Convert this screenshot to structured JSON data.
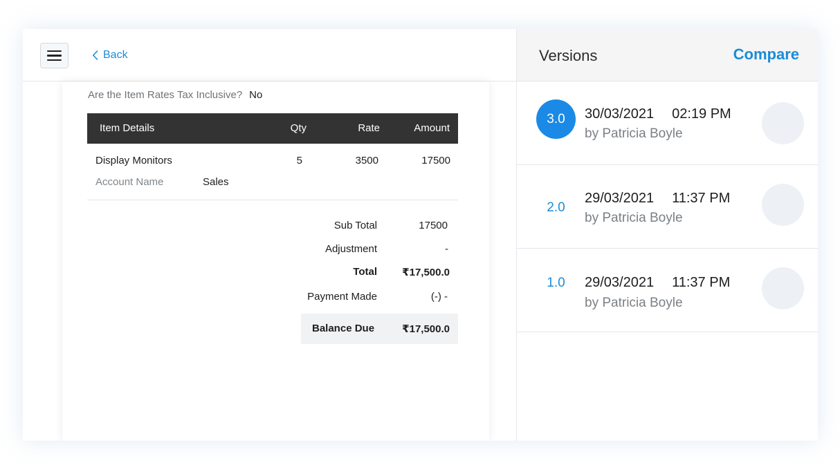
{
  "header": {
    "back_label": "Back"
  },
  "document": {
    "tax_question": "Are the Item Rates Tax Inclusive?",
    "tax_answer": "No",
    "table": {
      "columns": {
        "item": "Item Details",
        "qty": "Qty",
        "rate": "Rate",
        "amount": "Amount"
      },
      "rows": [
        {
          "name": "Display Monitors",
          "qty": "5",
          "rate": "3500",
          "amount": "17500",
          "account_label": "Account Name",
          "account_value": "Sales"
        }
      ]
    },
    "totals": {
      "subtotal_label": "Sub Total",
      "subtotal_value": "17500",
      "adjustment_label": "Adjustment",
      "adjustment_value": "-",
      "total_label": "Total",
      "total_value": "₹17,500.0",
      "payment_label": "Payment Made",
      "payment_value": "(-) -",
      "balance_label": "Balance Due",
      "balance_value": "₹17,500.0"
    }
  },
  "versions": {
    "title": "Versions",
    "compare_label": "Compare",
    "items": [
      {
        "version": "3.0",
        "date": "30/03/2021",
        "time": "02:19 PM",
        "by": "by Patricia Boyle",
        "active": true
      },
      {
        "version": "2.0",
        "date": "29/03/2021",
        "time": "11:37 PM",
        "by": "by Patricia Boyle",
        "active": false
      },
      {
        "version": "1.0",
        "date": "29/03/2021",
        "time": "11:37 PM",
        "by": "by Patricia Boyle",
        "active": false
      }
    ]
  },
  "colors": {
    "accent": "#1a8cd8",
    "active_badge": "#1a8ae6",
    "table_header": "#333333"
  }
}
